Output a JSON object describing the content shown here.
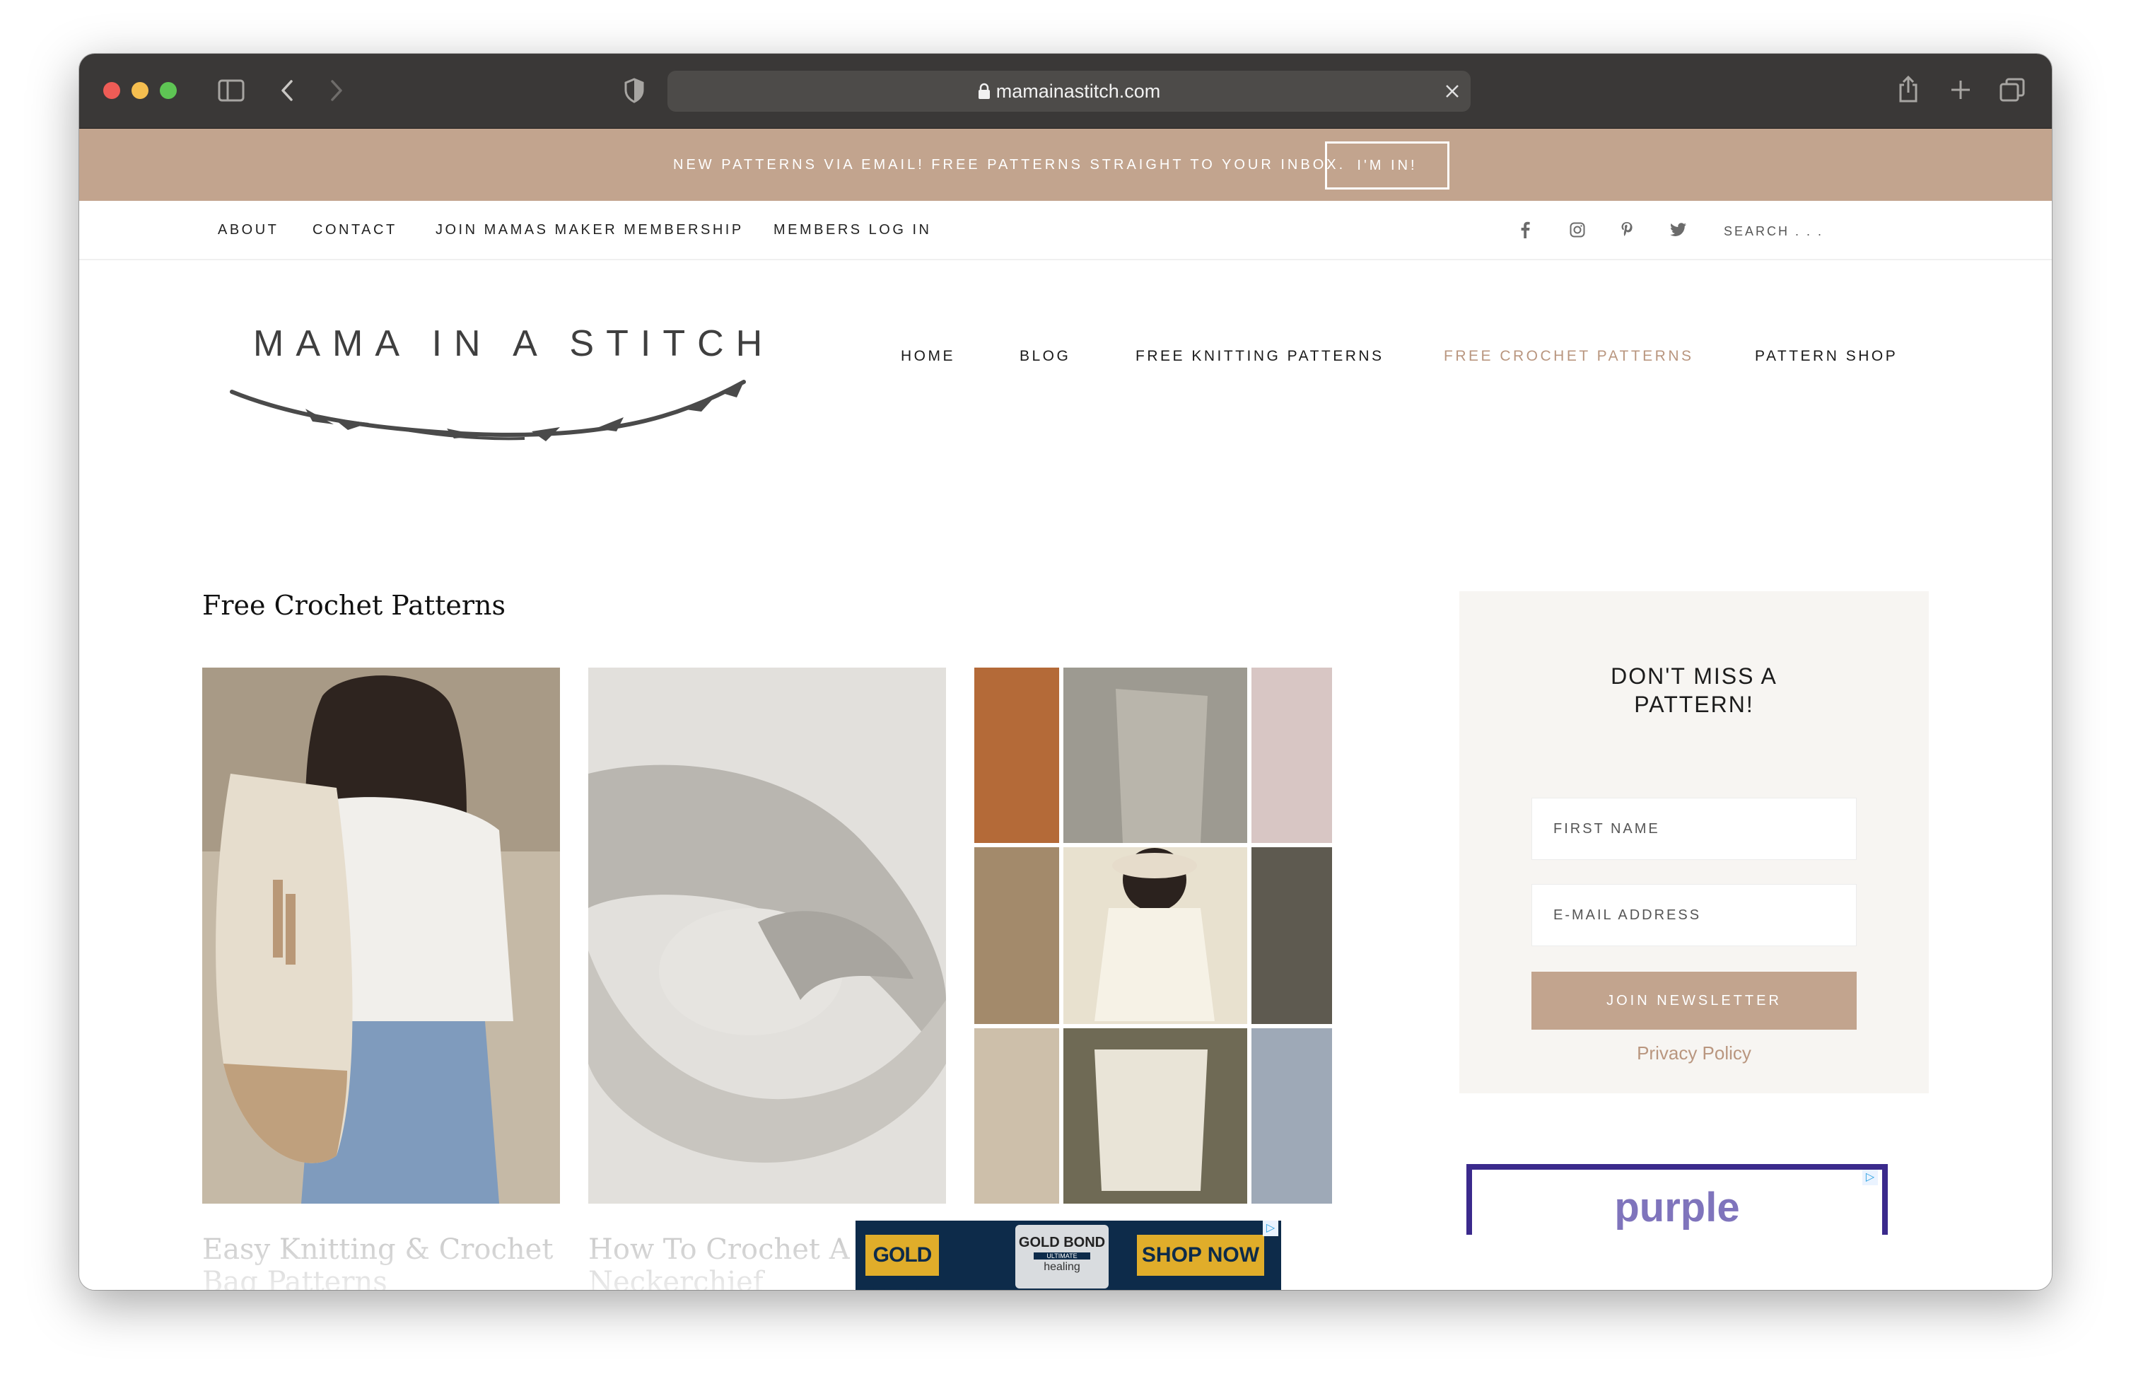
{
  "browser": {
    "url": "mamainastitch.com",
    "icons": [
      "sidebar-icon",
      "back-icon",
      "forward-icon",
      "shield-icon",
      "lock-icon",
      "close-icon",
      "share-icon",
      "new-tab-icon",
      "tabs-icon"
    ]
  },
  "promo": {
    "text": "NEW PATTERNS VIA EMAIL! FREE PATTERNS STRAIGHT TO YOUR INBOX.",
    "button": "I'M IN!"
  },
  "topnav": {
    "items": [
      "ABOUT",
      "CONTACT",
      "JOIN MAMAS MAKER MEMBERSHIP",
      "MEMBERS LOG IN"
    ],
    "social": [
      "facebook-icon",
      "instagram-icon",
      "pinterest-icon",
      "twitter-icon"
    ],
    "search_placeholder": "SEARCH . . ."
  },
  "header": {
    "logo": "MAMA IN A STITCH",
    "nav": [
      "HOME",
      "BLOG",
      "FREE KNITTING PATTERNS",
      "FREE CROCHET PATTERNS",
      "PATTERN SHOP"
    ],
    "active": "FREE CROCHET PATTERNS"
  },
  "main": {
    "title": "Free Crochet Patterns",
    "posts": [
      {
        "title": "Easy Knitting & Crochet Bag Patterns"
      },
      {
        "title": "How To Crochet A Neckerchief"
      }
    ]
  },
  "sidebar": {
    "heading_line1": "DON'T MISS A",
    "heading_line2": "PATTERN!",
    "first_name_placeholder": "FIRST NAME",
    "email_placeholder": "E-MAIL ADDRESS",
    "button": "JOIN NEWSLETTER",
    "privacy": "Privacy Policy"
  },
  "ads": {
    "right": "purple",
    "bottom_left": "GOLD BOND",
    "bottom_product": "GOLD BOND",
    "bottom_product_sub": "ULTIMATE",
    "bottom_product_line": "healing",
    "bottom_right": "SHOP NOW"
  },
  "colors": {
    "accent": "#c2a48e",
    "active_link": "#b9967f",
    "toolbar": "#3a3837"
  }
}
